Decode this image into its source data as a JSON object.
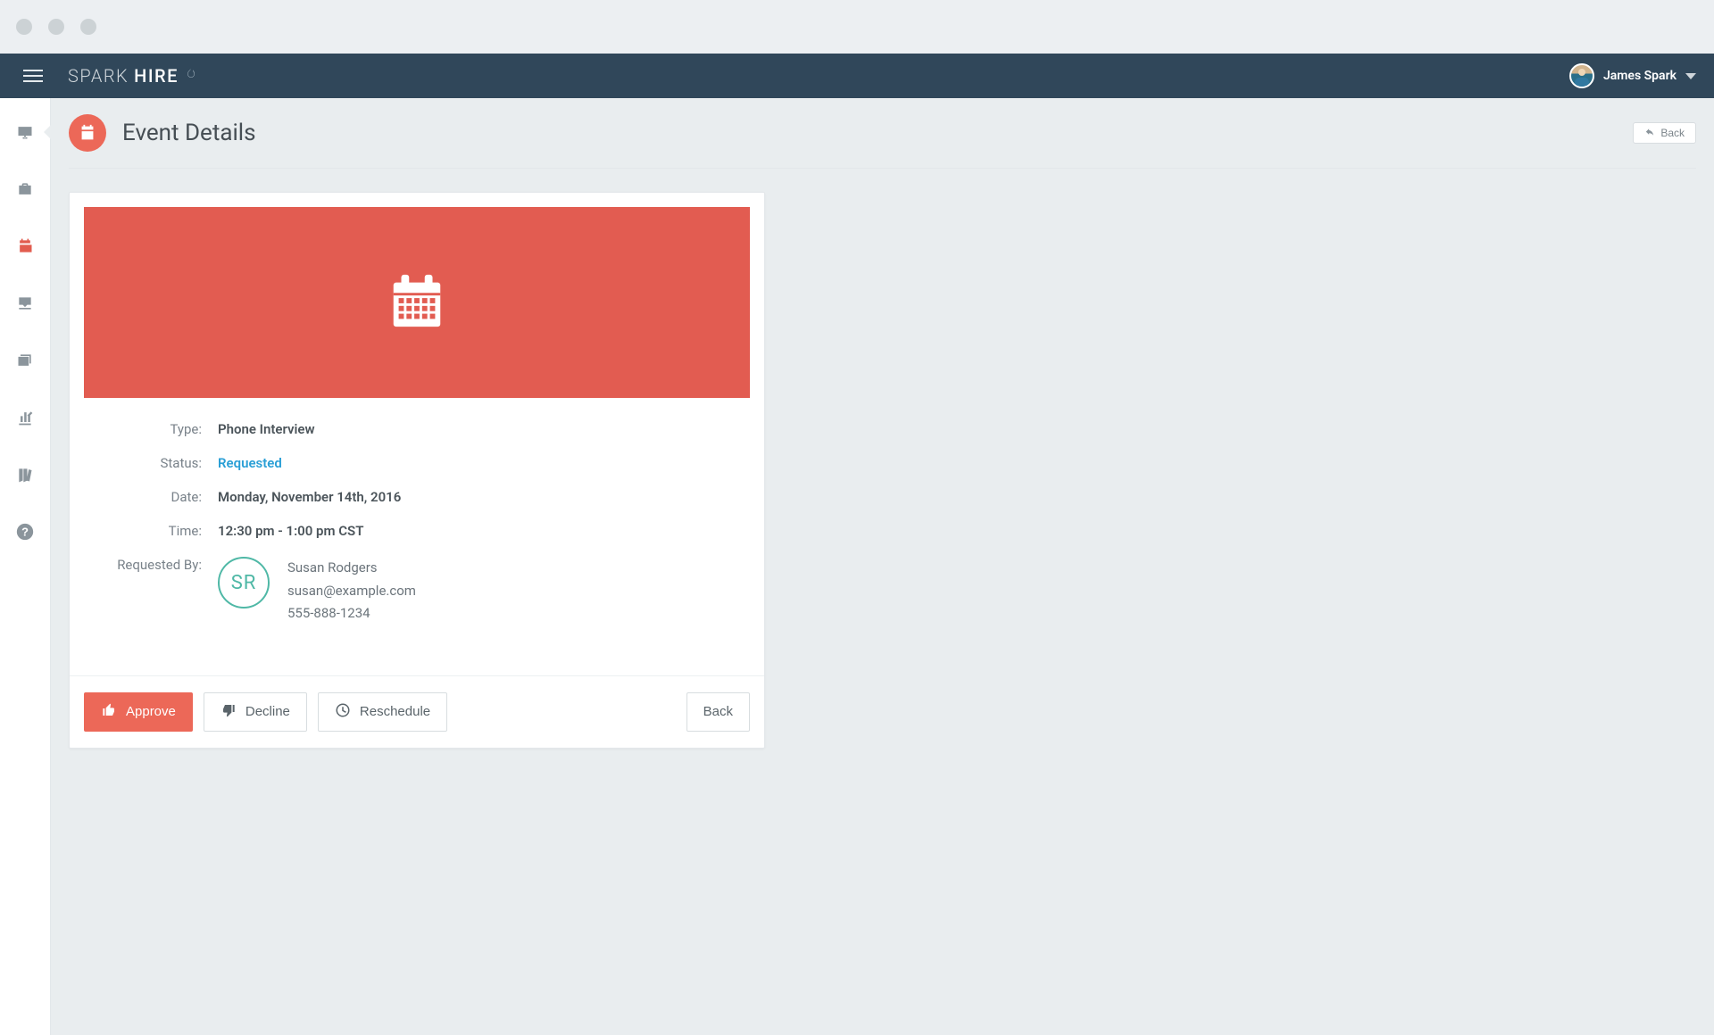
{
  "brand": {
    "part1": "SPARK",
    "part2": "HIRE"
  },
  "user": {
    "name": "James Spark"
  },
  "page": {
    "title": "Event Details"
  },
  "back_button": {
    "label": "Back"
  },
  "event": {
    "labels": {
      "type": "Type:",
      "status": "Status:",
      "date": "Date:",
      "time": "Time:",
      "requested_by": "Requested By:"
    },
    "type": "Phone Interview",
    "status": "Requested",
    "date": "Monday, November 14th, 2016",
    "time": "12:30 pm - 1:00 pm CST",
    "requester": {
      "initials": "SR",
      "name": "Susan Rodgers",
      "email": "susan@example.com",
      "phone": "555-888-1234"
    }
  },
  "actions": {
    "approve": "Approve",
    "decline": "Decline",
    "reschedule": "Reschedule",
    "back": "Back"
  }
}
